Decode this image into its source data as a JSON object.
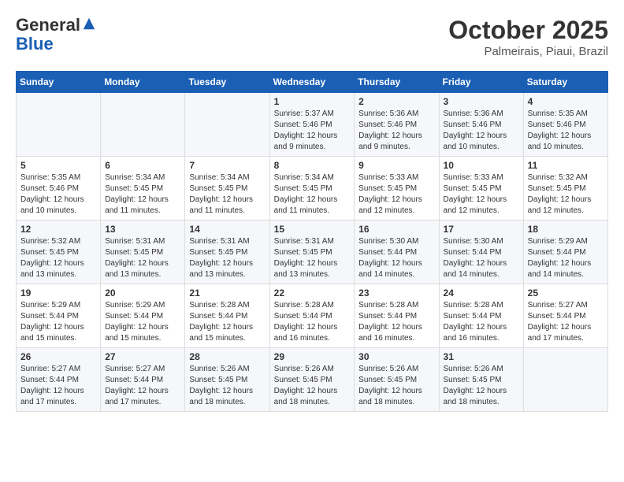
{
  "logo": {
    "general": "General",
    "blue": "Blue"
  },
  "header": {
    "month_year": "October 2025",
    "location": "Palmeirais, Piaui, Brazil"
  },
  "days_of_week": [
    "Sunday",
    "Monday",
    "Tuesday",
    "Wednesday",
    "Thursday",
    "Friday",
    "Saturday"
  ],
  "weeks": [
    [
      {
        "day": "",
        "info": ""
      },
      {
        "day": "",
        "info": ""
      },
      {
        "day": "",
        "info": ""
      },
      {
        "day": "1",
        "info": "Sunrise: 5:37 AM\nSunset: 5:46 PM\nDaylight: 12 hours and 9 minutes."
      },
      {
        "day": "2",
        "info": "Sunrise: 5:36 AM\nSunset: 5:46 PM\nDaylight: 12 hours and 9 minutes."
      },
      {
        "day": "3",
        "info": "Sunrise: 5:36 AM\nSunset: 5:46 PM\nDaylight: 12 hours and 10 minutes."
      },
      {
        "day": "4",
        "info": "Sunrise: 5:35 AM\nSunset: 5:46 PM\nDaylight: 12 hours and 10 minutes."
      }
    ],
    [
      {
        "day": "5",
        "info": "Sunrise: 5:35 AM\nSunset: 5:46 PM\nDaylight: 12 hours and 10 minutes."
      },
      {
        "day": "6",
        "info": "Sunrise: 5:34 AM\nSunset: 5:45 PM\nDaylight: 12 hours and 11 minutes."
      },
      {
        "day": "7",
        "info": "Sunrise: 5:34 AM\nSunset: 5:45 PM\nDaylight: 12 hours and 11 minutes."
      },
      {
        "day": "8",
        "info": "Sunrise: 5:34 AM\nSunset: 5:45 PM\nDaylight: 12 hours and 11 minutes."
      },
      {
        "day": "9",
        "info": "Sunrise: 5:33 AM\nSunset: 5:45 PM\nDaylight: 12 hours and 12 minutes."
      },
      {
        "day": "10",
        "info": "Sunrise: 5:33 AM\nSunset: 5:45 PM\nDaylight: 12 hours and 12 minutes."
      },
      {
        "day": "11",
        "info": "Sunrise: 5:32 AM\nSunset: 5:45 PM\nDaylight: 12 hours and 12 minutes."
      }
    ],
    [
      {
        "day": "12",
        "info": "Sunrise: 5:32 AM\nSunset: 5:45 PM\nDaylight: 12 hours and 13 minutes."
      },
      {
        "day": "13",
        "info": "Sunrise: 5:31 AM\nSunset: 5:45 PM\nDaylight: 12 hours and 13 minutes."
      },
      {
        "day": "14",
        "info": "Sunrise: 5:31 AM\nSunset: 5:45 PM\nDaylight: 12 hours and 13 minutes."
      },
      {
        "day": "15",
        "info": "Sunrise: 5:31 AM\nSunset: 5:45 PM\nDaylight: 12 hours and 13 minutes."
      },
      {
        "day": "16",
        "info": "Sunrise: 5:30 AM\nSunset: 5:44 PM\nDaylight: 12 hours and 14 minutes."
      },
      {
        "day": "17",
        "info": "Sunrise: 5:30 AM\nSunset: 5:44 PM\nDaylight: 12 hours and 14 minutes."
      },
      {
        "day": "18",
        "info": "Sunrise: 5:29 AM\nSunset: 5:44 PM\nDaylight: 12 hours and 14 minutes."
      }
    ],
    [
      {
        "day": "19",
        "info": "Sunrise: 5:29 AM\nSunset: 5:44 PM\nDaylight: 12 hours and 15 minutes."
      },
      {
        "day": "20",
        "info": "Sunrise: 5:29 AM\nSunset: 5:44 PM\nDaylight: 12 hours and 15 minutes."
      },
      {
        "day": "21",
        "info": "Sunrise: 5:28 AM\nSunset: 5:44 PM\nDaylight: 12 hours and 15 minutes."
      },
      {
        "day": "22",
        "info": "Sunrise: 5:28 AM\nSunset: 5:44 PM\nDaylight: 12 hours and 16 minutes."
      },
      {
        "day": "23",
        "info": "Sunrise: 5:28 AM\nSunset: 5:44 PM\nDaylight: 12 hours and 16 minutes."
      },
      {
        "day": "24",
        "info": "Sunrise: 5:28 AM\nSunset: 5:44 PM\nDaylight: 12 hours and 16 minutes."
      },
      {
        "day": "25",
        "info": "Sunrise: 5:27 AM\nSunset: 5:44 PM\nDaylight: 12 hours and 17 minutes."
      }
    ],
    [
      {
        "day": "26",
        "info": "Sunrise: 5:27 AM\nSunset: 5:44 PM\nDaylight: 12 hours and 17 minutes."
      },
      {
        "day": "27",
        "info": "Sunrise: 5:27 AM\nSunset: 5:44 PM\nDaylight: 12 hours and 17 minutes."
      },
      {
        "day": "28",
        "info": "Sunrise: 5:26 AM\nSunset: 5:45 PM\nDaylight: 12 hours and 18 minutes."
      },
      {
        "day": "29",
        "info": "Sunrise: 5:26 AM\nSunset: 5:45 PM\nDaylight: 12 hours and 18 minutes."
      },
      {
        "day": "30",
        "info": "Sunrise: 5:26 AM\nSunset: 5:45 PM\nDaylight: 12 hours and 18 minutes."
      },
      {
        "day": "31",
        "info": "Sunrise: 5:26 AM\nSunset: 5:45 PM\nDaylight: 12 hours and 18 minutes."
      },
      {
        "day": "",
        "info": ""
      }
    ]
  ]
}
